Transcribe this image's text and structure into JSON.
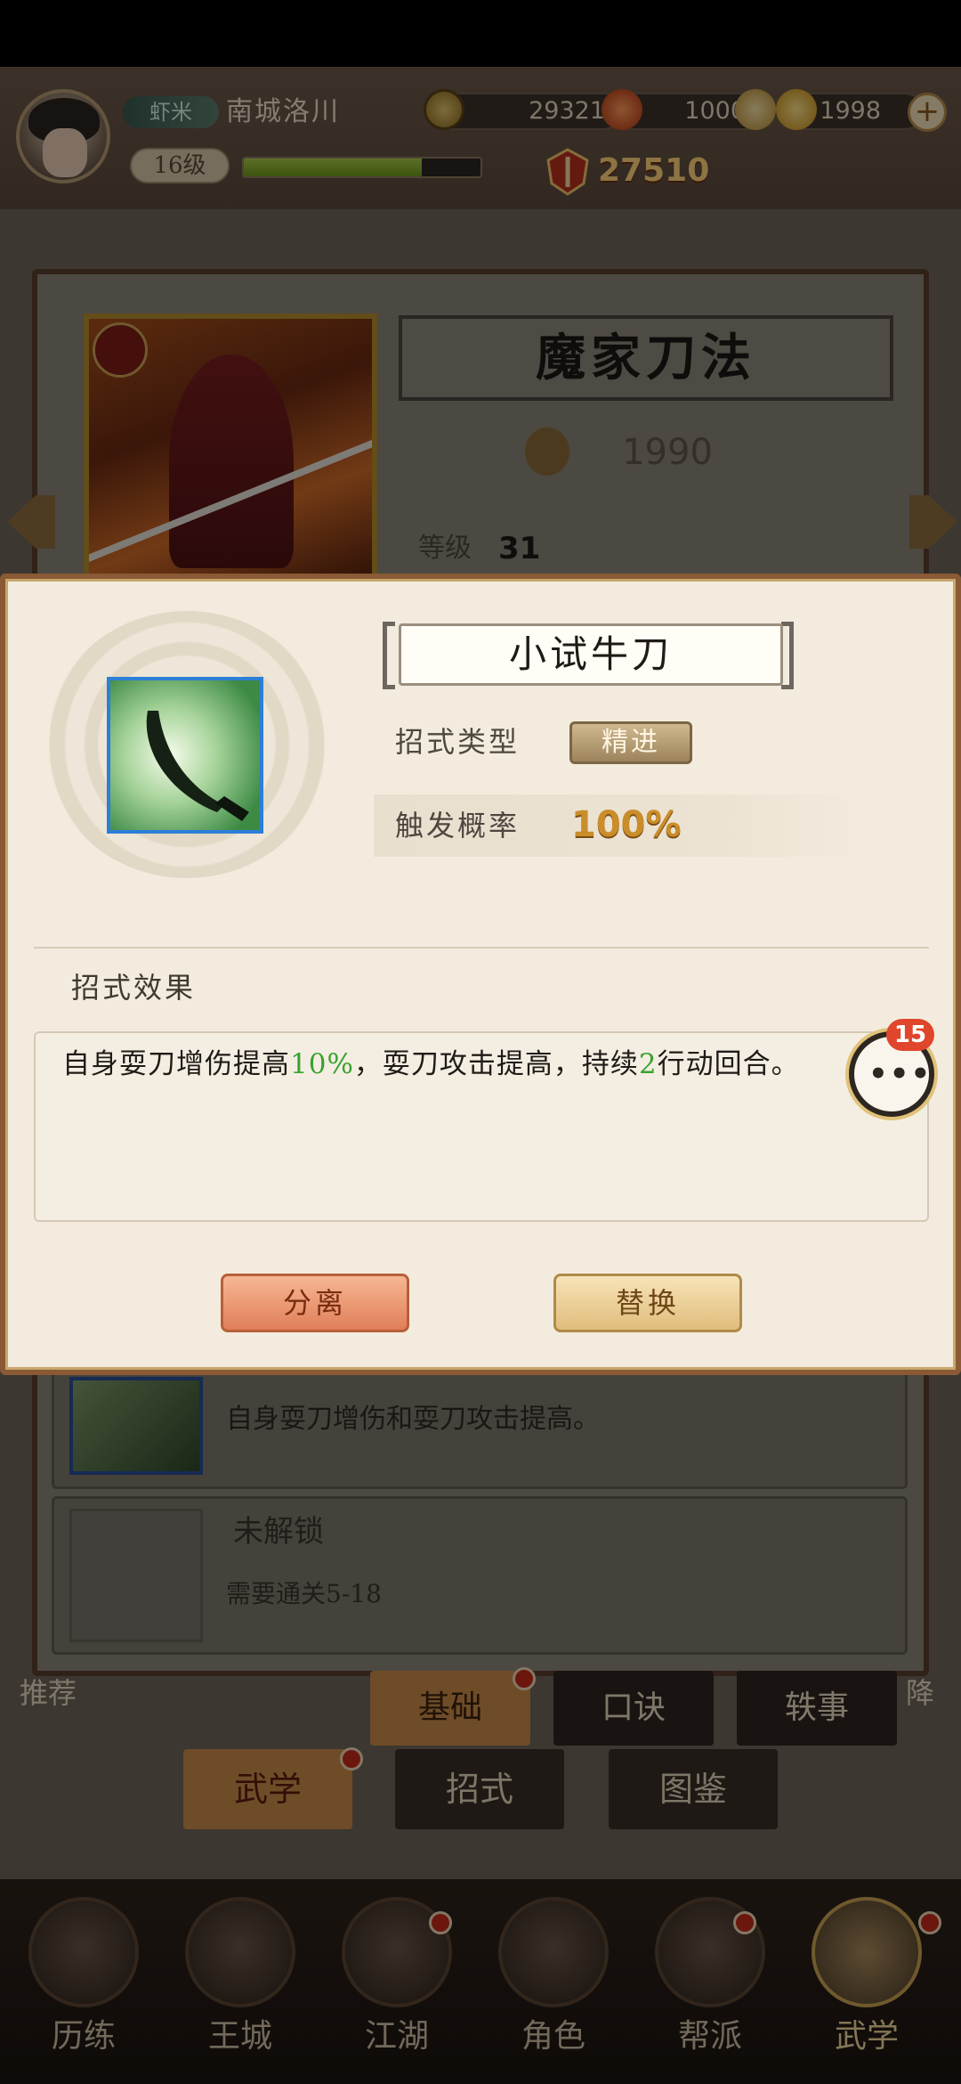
{
  "header": {
    "rank_badge": "虾米",
    "player_name": "南城洛川",
    "level": "16级",
    "xp_fraction": 0.75,
    "copper": "29321",
    "gem": "1000",
    "gold": "1998",
    "power": "27510"
  },
  "background": {
    "art_title": "魔家刀法",
    "score": "1990",
    "level_label": "等级",
    "level_value": "31",
    "row_description": "自身耍刀增伤和耍刀攻击提高。",
    "locked_label": "未解锁",
    "locked_requirement": "需要通关5-18",
    "left_side": "推荐",
    "right_side": "降",
    "subtabs": [
      "基础",
      "口诀",
      "轶事"
    ],
    "tabs": [
      "武学",
      "招式",
      "图鉴"
    ]
  },
  "dialog": {
    "skill_name": "小试牛刀",
    "type_label": "招式类型",
    "type_value": "精进",
    "trigger_label": "触发概率",
    "trigger_value": "100%",
    "effect_title": "招式效果",
    "effect_parts": {
      "p1": "自身耍刀增伤提高",
      "v1": "10%",
      "p2": "，耍刀攻击提高，持续",
      "v2": "2",
      "p3": "行动回合。"
    },
    "separate_button": "分离",
    "replace_button": "替换"
  },
  "chat": {
    "badge": "15",
    "dots": "•••"
  },
  "bottom_nav": [
    "历练",
    "王城",
    "江湖",
    "角色",
    "帮派",
    "武学"
  ],
  "colors": {
    "highlight_green": "#3aa22f",
    "accent_gold": "#c98d2a",
    "frame_brown": "#8a5a35"
  }
}
